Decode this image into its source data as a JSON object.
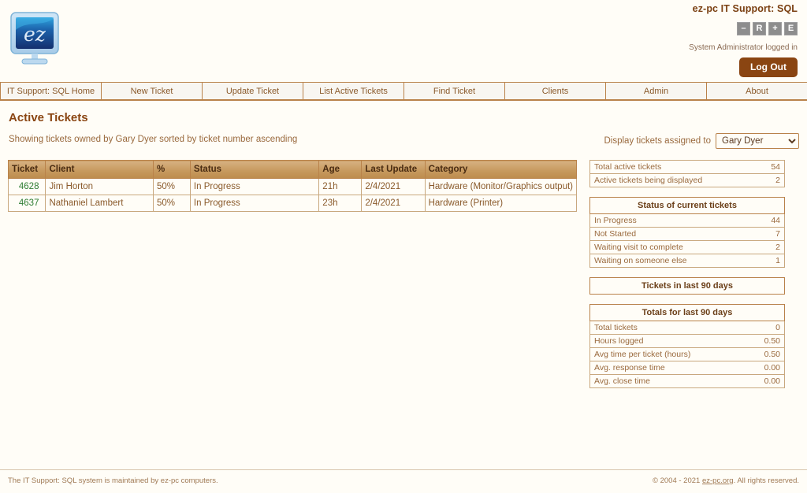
{
  "header": {
    "app_title": "ez-pc IT Support: SQL",
    "logo_text": "ez",
    "window_buttons": [
      {
        "name": "minimize-button",
        "label": "–"
      },
      {
        "name": "restore-button",
        "label": "R"
      },
      {
        "name": "maximize-button",
        "label": "+"
      },
      {
        "name": "exit-button",
        "label": "E"
      }
    ],
    "logged_in_text": "System Administrator logged in",
    "logout_label": "Log Out"
  },
  "nav": {
    "items": [
      {
        "label": "IT Support: SQL Home"
      },
      {
        "label": "New Ticket"
      },
      {
        "label": "Update Ticket"
      },
      {
        "label": "List Active Tickets"
      },
      {
        "label": "Find Ticket"
      },
      {
        "label": "Clients"
      },
      {
        "label": "Admin"
      },
      {
        "label": "About"
      }
    ]
  },
  "main": {
    "page_title": "Active Tickets",
    "subtitle": "Showing tickets owned by Gary Dyer sorted by ticket number ascending",
    "assign_label": "Display tickets assigned to",
    "assign_selected": "Gary Dyer",
    "assign_options": [
      "Gary Dyer"
    ],
    "table": {
      "columns": [
        "Ticket",
        "Client",
        "%",
        "Status",
        "Age",
        "Last Update",
        "Category"
      ],
      "rows": [
        {
          "ticket": "4628",
          "client": "Jim Horton",
          "percent": "50%",
          "status": "In Progress",
          "age": "21h",
          "last_update": "2/4/2021",
          "category": "Hardware (Monitor/Graphics output)"
        },
        {
          "ticket": "4637",
          "client": "Nathaniel Lambert",
          "percent": "50%",
          "status": "In Progress",
          "age": "23h",
          "last_update": "2/4/2021",
          "category": "Hardware (Printer)"
        }
      ]
    }
  },
  "sidebar": {
    "counts_panel": {
      "rows": [
        {
          "label": "Total active tickets",
          "value": "54"
        },
        {
          "label": "Active tickets being displayed",
          "value": "2"
        }
      ]
    },
    "status_panel": {
      "title": "Status of current tickets",
      "rows": [
        {
          "label": "In Progress",
          "value": "44"
        },
        {
          "label": "Not Started",
          "value": "7"
        },
        {
          "label": "Waiting visit to complete",
          "value": "2"
        },
        {
          "label": "Waiting on someone else",
          "value": "1"
        }
      ]
    },
    "tickets_90_title": "Tickets in last 90 days",
    "totals_panel": {
      "title": "Totals for last 90 days",
      "rows": [
        {
          "label": "Total tickets",
          "value": "0"
        },
        {
          "label": "Hours logged",
          "value": "0.50"
        },
        {
          "label": "Avg time per ticket (hours)",
          "value": "0.50"
        },
        {
          "label": "Avg. response time",
          "value": "0.00"
        },
        {
          "label": "Avg. close time",
          "value": "0.00"
        }
      ]
    }
  },
  "footer": {
    "left": "The IT Support: SQL system is maintained by ez-pc computers.",
    "right_prefix": "© 2004 - 2021 ",
    "right_link": "ez-pc.org",
    "right_suffix": ". All rights reserved."
  },
  "colors": {
    "accent_brown": "#8a4512",
    "border_brown": "#b9824a",
    "table_header": "#c79a60",
    "link_green": "#2e7d32",
    "page_bg": "#fffdf7"
  }
}
